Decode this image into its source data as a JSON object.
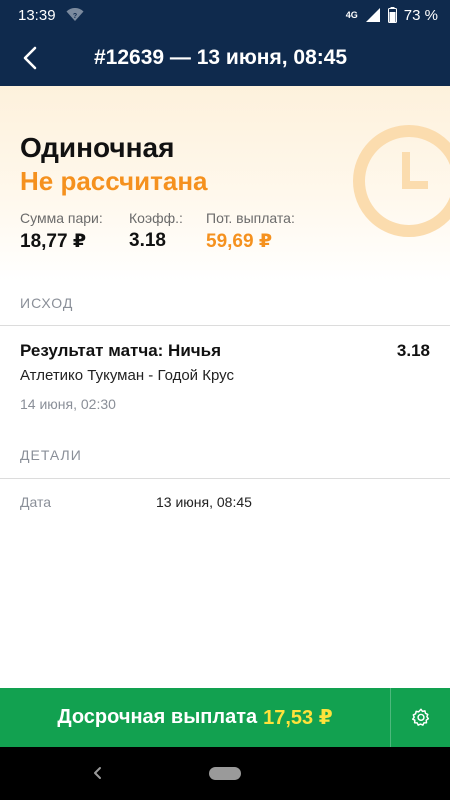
{
  "status_bar": {
    "time": "13:39",
    "network": "4G",
    "battery": "73 %"
  },
  "header": {
    "title": "#12639 — 13 июня, 08:45",
    "back_icon": "back-arrow-icon"
  },
  "summary": {
    "bet_type": "Одиночная",
    "status": "Не рассчитана",
    "status_color": "#f5911e",
    "stake_label": "Сумма пари:",
    "stake_value": "18,77 ₽",
    "odds_label": "Коэфф.:",
    "odds_value": "3.18",
    "payout_label": "Пот. выплата:",
    "payout_value": "59,69 ₽"
  },
  "outcome": {
    "section_title": "ИСХОД",
    "title": "Результат матча: Ничья",
    "odds": "3.18",
    "teams": "Атлетико Тукуман - Годой Крус",
    "date": "14 июня, 02:30"
  },
  "details": {
    "section_title": "ДЕТАЛИ",
    "date_label": "Дата",
    "date_value": "13 июня, 08:45"
  },
  "cashout": {
    "label": "Досрочная выплата",
    "amount": "17,53 ₽",
    "bar_color": "#12a150",
    "amount_color": "#ffe23b"
  },
  "colors": {
    "header_bg": "#0f2a4d",
    "accent": "#f5911e"
  }
}
